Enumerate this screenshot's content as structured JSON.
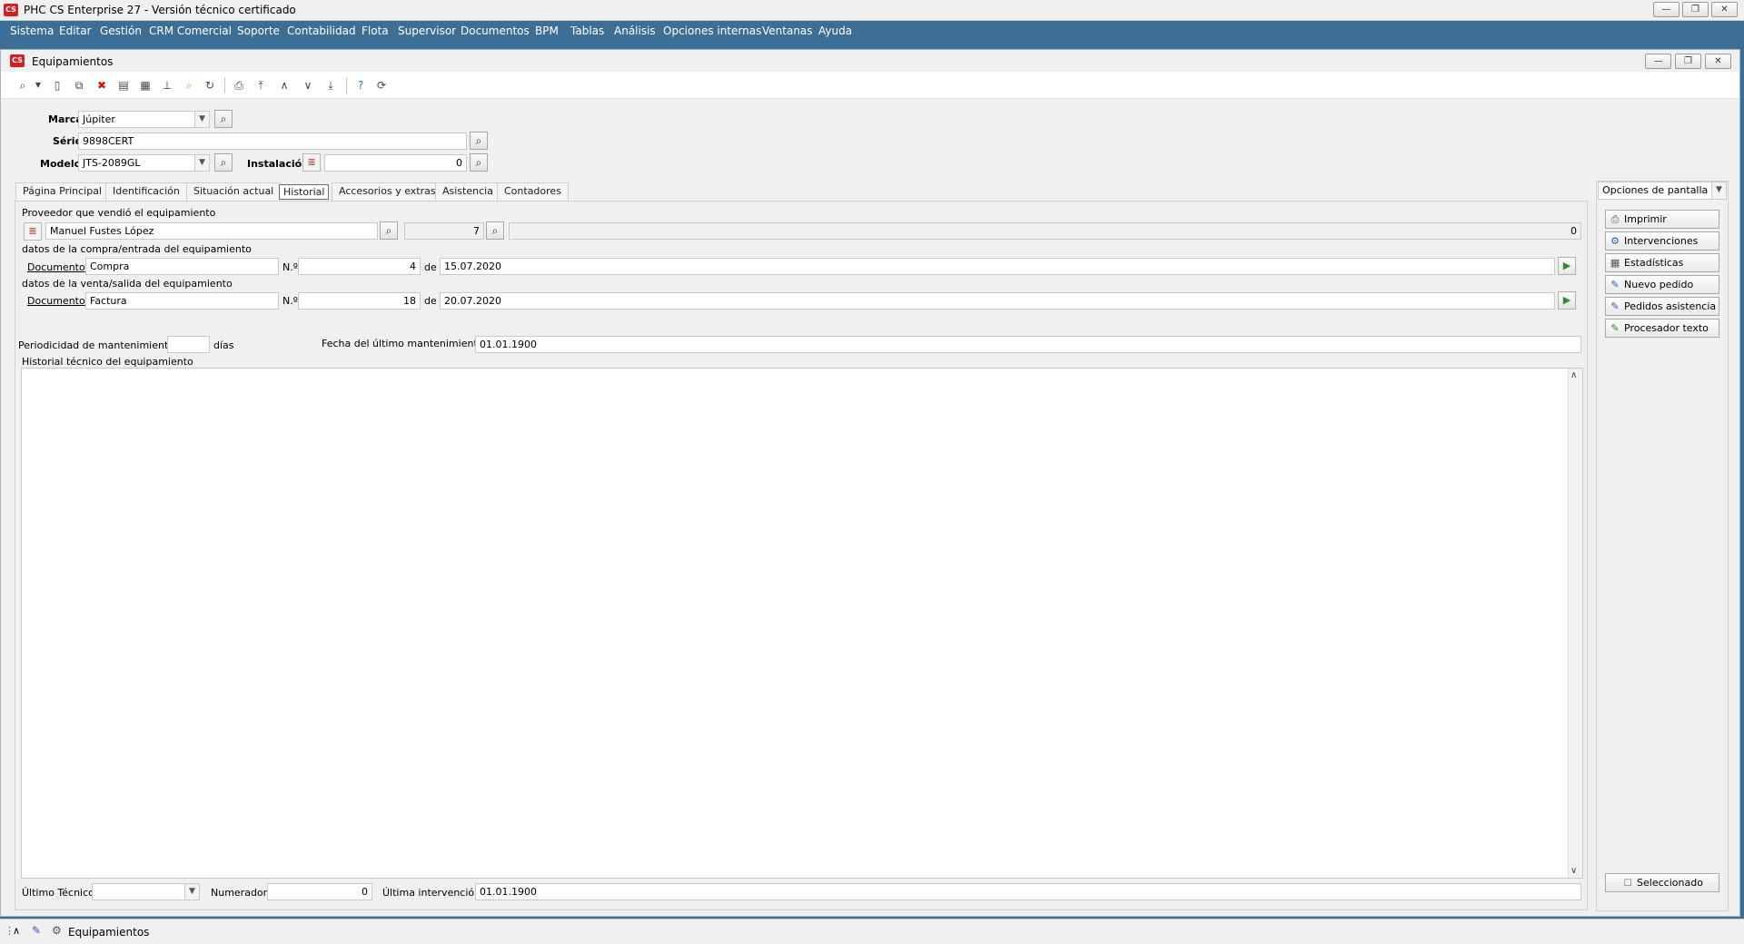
{
  "app": {
    "title": "PHC CS Enterprise 27 - Versión técnico certificado",
    "logo_text": "CS",
    "window_buttons": [
      "—",
      "❐",
      "✕"
    ]
  },
  "menu": [
    "Sistema",
    "Editar",
    "Gestión",
    "CRM Comercial",
    "Soporte",
    "Contabilidad",
    "Flota",
    "Supervisor",
    "Documentos",
    "BPM",
    "Tablas",
    "Análisis",
    "Opciones internas",
    "Ventanas",
    "Ayuda"
  ],
  "window": {
    "title": "Equipamientos",
    "buttons": [
      "—",
      "❐",
      "✕"
    ]
  },
  "header": {
    "marca_label": "Marca",
    "marca_value": "Júpiter",
    "serie_label": "Série",
    "serie_value": "9898CERT",
    "modelo_label": "Modelo",
    "modelo_value": "JTS-2089GL",
    "instalacion_label": "Instalación",
    "instalacion_value": "0"
  },
  "tabs": [
    "Página Principal",
    "Identificación",
    "Situación actual",
    "Historial",
    "Accesorios y extras",
    "Asistencia",
    "Contadores"
  ],
  "active_tab": "Historial",
  "historial": {
    "proveedor_title": "Proveedor que vendió el equipamiento",
    "proveedor_name": "Manuel Fustes López",
    "proveedor_num": "7",
    "proveedor_extra": "0",
    "compra_title": "datos de la compra/entrada del equipamiento",
    "documento_label": "Documento",
    "compra_doc": "Compra",
    "n_label": "N.º",
    "compra_n": "4",
    "de_label": "de",
    "compra_date": "15.07.2020",
    "venta_title": "datos de la venta/salida del equipamiento",
    "venta_doc": "Factura",
    "venta_n": "18",
    "venta_date": "20.07.2020",
    "periodicidad_label": "Periodicidad de mantenimiento",
    "periodicidad_value": "",
    "dias_label": "días",
    "fecha_ult_label": "Fecha del último mantenimiento",
    "fecha_ult_value": "01.01.1900",
    "historial_tecnico_label": "Historial técnico del equipamiento",
    "historial_tecnico_value": "",
    "ultimo_tecnico_label": "Último Técnico",
    "ultimo_tecnico_value": "",
    "numerador_label": "Numerador",
    "numerador_value": "0",
    "ultima_intervencion_label": "Última intervención",
    "ultima_intervencion_value": "01.01.1900"
  },
  "side": {
    "opciones_label": "Opciones de pantalla",
    "buttons": [
      {
        "label": "Imprimir",
        "icon": "printer-icon"
      },
      {
        "label": "Intervenciones",
        "icon": "gears-icon"
      },
      {
        "label": "Estadísticas",
        "icon": "grid-icon"
      },
      {
        "label": "Nuevo pedido",
        "icon": "new-order-icon"
      },
      {
        "label": "Pedidos asistencia",
        "icon": "assist-orders-icon"
      },
      {
        "label": "Procesador texto",
        "icon": "text-editor-icon"
      }
    ],
    "seleccionado_label": "Seleccionado"
  },
  "statusbar": {
    "task_label": "Equipamientos"
  }
}
